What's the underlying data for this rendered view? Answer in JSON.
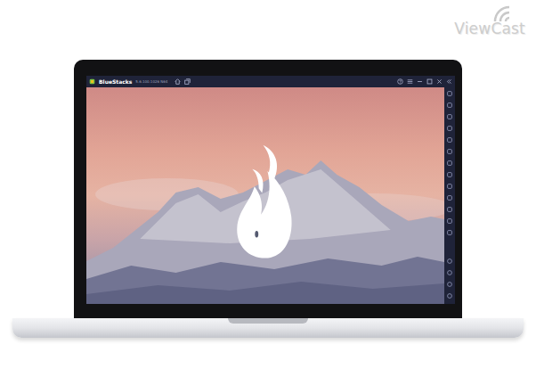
{
  "watermark": {
    "text": "ViewCast"
  },
  "window": {
    "title": "BlueStacks",
    "version": "5.6.100.1026 N64"
  }
}
